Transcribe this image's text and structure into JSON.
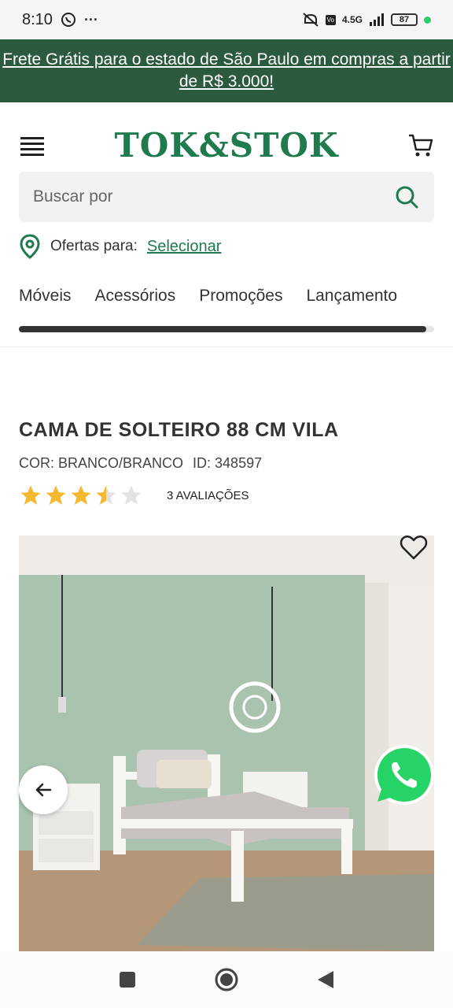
{
  "status_bar": {
    "time": "8:10",
    "more": "···",
    "network": "4.5G",
    "battery": "87"
  },
  "promo": {
    "text": "Frete Grátis para o estado de São Paulo em compras a partir de R$ 3.000!"
  },
  "header": {
    "logo": "TOK&STOK",
    "brand_color": "#1f7a4d"
  },
  "search": {
    "placeholder": "Buscar por"
  },
  "offers": {
    "label": "Ofertas para:",
    "link": "Selecionar"
  },
  "nav": {
    "items": [
      {
        "label": "Móveis"
      },
      {
        "label": "Acessórios"
      },
      {
        "label": "Promoções"
      },
      {
        "label": "Lançamento"
      }
    ],
    "scroll_position": 0.98
  },
  "product": {
    "title": "CAMA DE SOLTEIRO 88 CM VILA",
    "color": "COR: BRANCO/BRANCO",
    "id": "ID: 348597",
    "rating_value": 3.5,
    "rating_max": 5,
    "reviews": "3 AVALIAÇÕES"
  },
  "icons": {
    "menu": "menu-icon",
    "cart": "cart-icon",
    "search": "search-icon",
    "location": "location-pin-icon",
    "wishlist": "heart-icon",
    "prev": "arrow-left-icon",
    "whatsapp": "whatsapp-icon"
  }
}
